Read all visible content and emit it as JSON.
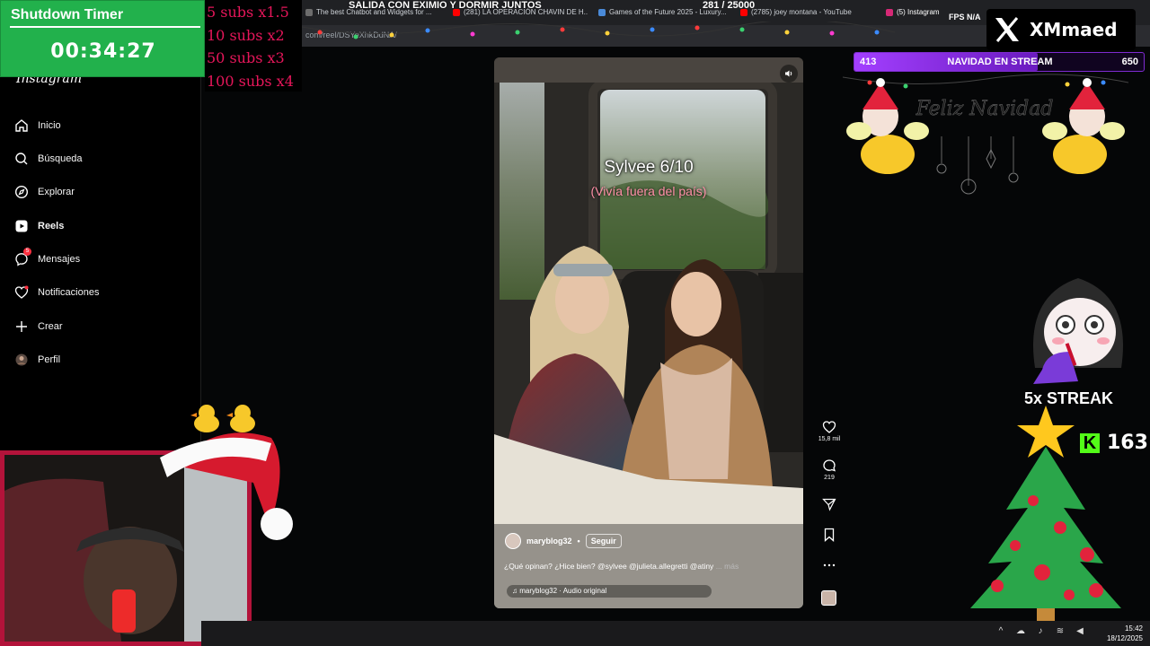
{
  "browser": {
    "tabs": [
      {
        "label": "The best Chatbot and Widgets for ...",
        "icon": "browser-tab-icon"
      },
      {
        "label": "(281) LA OPERACIÓN CHAVIN DE H...",
        "icon": "youtube-icon"
      },
      {
        "label": "Games of the Future 2025 - Luxury...",
        "icon": "browser-tab-icon"
      },
      {
        "label": "(2785) joey montana - YouTube",
        "icon": "youtube-icon"
      },
      {
        "label": "(5) Instagram",
        "icon": "instagram-icon"
      }
    ],
    "url": "com/reel/DSYeXhkDdNA/"
  },
  "stream": {
    "title": "SALIDA CON EXIMIO Y DORMIR JUNTOS",
    "sub_goal": "281  / 25000",
    "fps": "FPS  N/A"
  },
  "timer": {
    "title": "Shutdown Timer",
    "value": "00:34:27"
  },
  "subs_multipliers": [
    "5 subs x1.5",
    "10 subs x2",
    "50 subs x3",
    "100 subs x4"
  ],
  "instagram": {
    "logo": "Instagram",
    "nav": [
      {
        "label": "Inicio",
        "icon": "home-icon"
      },
      {
        "label": "Búsqueda",
        "icon": "search-icon"
      },
      {
        "label": "Explorar",
        "icon": "compass-icon"
      },
      {
        "label": "Reels",
        "icon": "reels-icon"
      },
      {
        "label": "Mensajes",
        "icon": "messenger-icon",
        "badge": "5"
      },
      {
        "label": "Notificaciones",
        "icon": "heart-icon"
      },
      {
        "label": "Crear",
        "icon": "plus-icon"
      },
      {
        "label": "Perfil",
        "icon": "profile-avatar"
      }
    ]
  },
  "reel": {
    "overlay_title": "Sylvee 6/10",
    "overlay_subtitle": "(Vivía fuera del país)",
    "username": "maryblog32",
    "follow": "Seguir",
    "caption": "¿Qué opinan? ¿Hice bien? @sylvee @julieta.allegretti @atiny",
    "more": "... más",
    "audio": "maryblog32 · Audio original",
    "likes": "15,8 mil",
    "comments": "219"
  },
  "right_overlay": {
    "brand": "XMmaed",
    "goal_left": "413",
    "goal_title": "NAVIDAD EN STREAM",
    "goal_right": "650",
    "goal_progress": 0.635,
    "greeting": "Feliz Navidad",
    "streak": "5x STREAK",
    "kick_count": "163"
  },
  "taskbar": {
    "time": "15:42",
    "date": "18/12/2025"
  },
  "colors": {
    "timer_bg": "#22b14c",
    "subs_text": "#e6165a",
    "goal_purple": "#a33fff",
    "kick_green": "#53fc18",
    "cam_border": "#b3133a"
  }
}
